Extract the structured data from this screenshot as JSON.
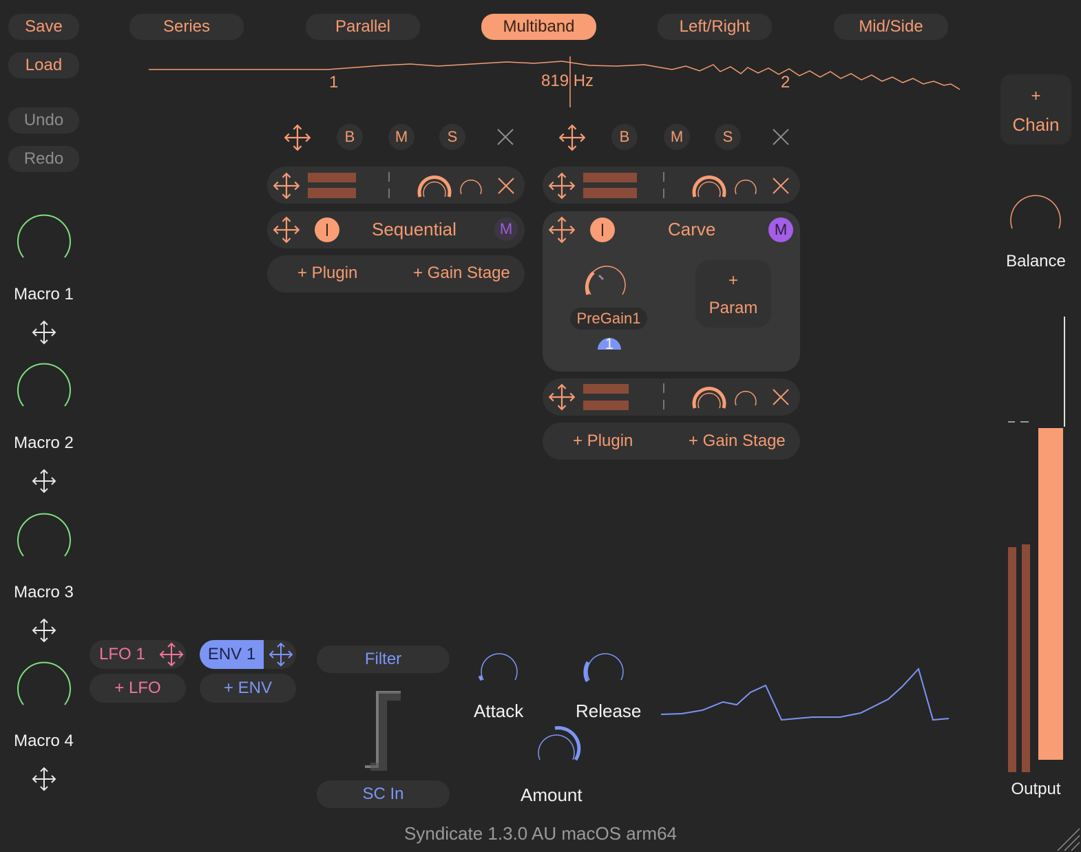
{
  "sidebar": {
    "save": "Save",
    "load": "Load",
    "undo": "Undo",
    "redo": "Redo",
    "macros": [
      "Macro 1",
      "Macro 2",
      "Macro 3",
      "Macro 4"
    ]
  },
  "routing_tabs": [
    {
      "label": "Series",
      "active": false
    },
    {
      "label": "Parallel",
      "active": false
    },
    {
      "label": "Multiband",
      "active": true
    },
    {
      "label": "Left/Right",
      "active": false
    },
    {
      "label": "Mid/Side",
      "active": false
    }
  ],
  "spectrum": {
    "band_left": "1",
    "crossover": "819 Hz",
    "band_right": "2"
  },
  "bands": [
    {
      "header_buttons": [
        "B",
        "M",
        "S"
      ],
      "chain_label": "Sequential",
      "chain_mod_badge": "M",
      "add_plugin": "+ Plugin",
      "add_gain_stage": "+ Gain Stage"
    },
    {
      "header_buttons": [
        "B",
        "M",
        "S"
      ],
      "chain_label": "Carve",
      "chain_mod_badge": "M",
      "param_name": "PreGain1",
      "param_mod_index": "1",
      "add_param_plus": "+",
      "add_param": "Param",
      "add_plugin": "+ Plugin",
      "add_gain_stage": "+ Gain Stage"
    }
  ],
  "right_panel": {
    "add_chain_plus": "+",
    "add_chain": "Chain",
    "balance": "Balance",
    "output": "Output"
  },
  "modulation": {
    "lfo": "LFO 1",
    "add_lfo": "+ LFO",
    "env": "ENV 1",
    "add_env": "+ ENV",
    "filter": "Filter",
    "sc_in": "SC In",
    "attack": "Attack",
    "release": "Release",
    "amount": "Amount"
  },
  "footer": {
    "version": "Syndicate 1.3.0 AU macOS arm64"
  },
  "colors": {
    "accent_orange": "#f89d74",
    "macro_green": "#7ee07e",
    "env_blue": "#7c95f5",
    "lfo_pink": "#f0759a",
    "mod_purple": "#a45ee8"
  }
}
